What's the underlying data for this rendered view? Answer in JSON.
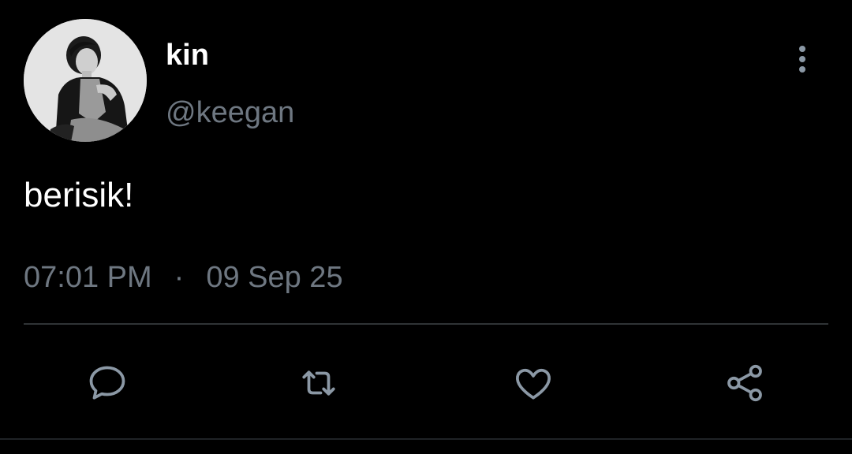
{
  "user": {
    "display_name": "kin",
    "handle": "@keegan",
    "avatar": "profile-photo"
  },
  "tweet": {
    "text": "berisik!",
    "time": "07:01 PM",
    "separator": "·",
    "date": "09 Sep 25"
  },
  "actions": {
    "reply": "reply-icon",
    "retweet": "retweet-icon",
    "like": "heart-icon",
    "share": "share-icon",
    "more": "more-vertical-icon"
  },
  "colors": {
    "background": "#000000",
    "primary_text": "#ffffff",
    "secondary_text": "#6e7781",
    "icon": "#8b98a5",
    "divider": "#2f3336"
  }
}
